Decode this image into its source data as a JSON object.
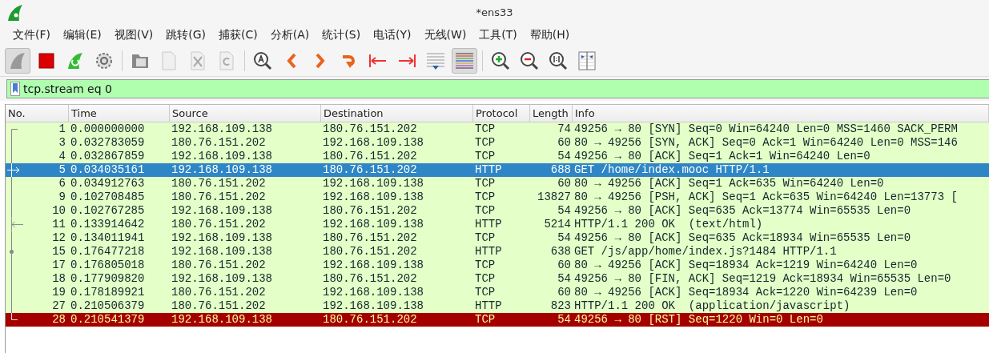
{
  "window": {
    "title": "*ens33"
  },
  "menu": [
    "文件(F)",
    "编辑(E)",
    "视图(V)",
    "跳转(G)",
    "捕获(C)",
    "分析(A)",
    "统计(S)",
    "电话(Y)",
    "无线(W)",
    "工具(T)",
    "帮助(H)"
  ],
  "toolbar": [
    {
      "kind": "start",
      "pressed": true,
      "disabled": false
    },
    {
      "kind": "stop",
      "pressed": false,
      "disabled": false
    },
    {
      "kind": "restart",
      "pressed": false,
      "disabled": false
    },
    {
      "kind": "options",
      "pressed": false,
      "disabled": false
    },
    {
      "kind": "sep"
    },
    {
      "kind": "open",
      "pressed": false,
      "disabled": false
    },
    {
      "kind": "save",
      "pressed": false,
      "disabled": true
    },
    {
      "kind": "close",
      "pressed": false,
      "disabled": true
    },
    {
      "kind": "reload",
      "pressed": false,
      "disabled": true
    },
    {
      "kind": "sep"
    },
    {
      "kind": "find",
      "pressed": false,
      "disabled": false
    },
    {
      "kind": "back",
      "pressed": false,
      "disabled": false
    },
    {
      "kind": "forward",
      "pressed": false,
      "disabled": false
    },
    {
      "kind": "goto",
      "pressed": false,
      "disabled": false
    },
    {
      "kind": "first",
      "pressed": false,
      "disabled": false
    },
    {
      "kind": "last",
      "pressed": false,
      "disabled": false
    },
    {
      "kind": "autoscroll",
      "pressed": false,
      "disabled": false
    },
    {
      "kind": "colorize",
      "pressed": true,
      "disabled": false
    },
    {
      "kind": "sep"
    },
    {
      "kind": "zoom_in",
      "pressed": false,
      "disabled": false
    },
    {
      "kind": "zoom_out",
      "pressed": false,
      "disabled": false
    },
    {
      "kind": "zoom_reset",
      "pressed": false,
      "disabled": false
    },
    {
      "kind": "resize",
      "pressed": false,
      "disabled": false
    }
  ],
  "filter": {
    "value": "tcp.stream eq 0"
  },
  "table": {
    "columns": [
      "No.",
      "Time",
      "Source",
      "Destination",
      "Protocol",
      "Length",
      "Info"
    ],
    "rows": [
      {
        "cells": [
          "1",
          "0.000000000",
          "192.168.109.138",
          "180.76.151.202",
          "TCP",
          "74",
          "49256 → 80 [SYN] Seq=0 Win=64240 Len=0 MSS=1460 SACK_PERM"
        ],
        "selected": false,
        "error": false,
        "kind": "first"
      },
      {
        "cells": [
          "3",
          "0.032783059",
          "180.76.151.202",
          "192.168.109.138",
          "TCP",
          "60",
          "80 → 49256 [SYN, ACK] Seq=0 Ack=1 Win=64240 Len=0 MSS=146"
        ],
        "selected": false,
        "error": false,
        "kind": "member"
      },
      {
        "cells": [
          "4",
          "0.032867859",
          "192.168.109.138",
          "180.76.151.202",
          "TCP",
          "54",
          "49256 → 80 [ACK] Seq=1 Ack=1 Win=64240 Len=0"
        ],
        "selected": false,
        "error": false,
        "kind": "member"
      },
      {
        "cells": [
          "5",
          "0.034035161",
          "192.168.109.138",
          "180.76.151.202",
          "HTTP",
          "688",
          "GET /home/index.mooc HTTP/1.1"
        ],
        "selected": true,
        "error": false,
        "kind": "request"
      },
      {
        "cells": [
          "6",
          "0.034912763",
          "180.76.151.202",
          "192.168.109.138",
          "TCP",
          "60",
          "80 → 49256 [ACK] Seq=1 Ack=635 Win=64240 Len=0"
        ],
        "selected": false,
        "error": false,
        "kind": "member"
      },
      {
        "cells": [
          "9",
          "0.102708485",
          "180.76.151.202",
          "192.168.109.138",
          "TCP",
          "13827",
          "80 → 49256 [PSH, ACK] Seq=1 Ack=635 Win=64240 Len=13773 ["
        ],
        "selected": false,
        "error": false,
        "kind": "member"
      },
      {
        "cells": [
          "10",
          "0.102767285",
          "192.168.109.138",
          "180.76.151.202",
          "TCP",
          "54",
          "49256 → 80 [ACK] Seq=635 Ack=13774 Win=65535 Len=0"
        ],
        "selected": false,
        "error": false,
        "kind": "member"
      },
      {
        "cells": [
          "11",
          "0.133914642",
          "180.76.151.202",
          "192.168.109.138",
          "HTTP",
          "5214",
          "HTTP/1.1 200 OK  (text/html)"
        ],
        "selected": false,
        "error": false,
        "kind": "response"
      },
      {
        "cells": [
          "12",
          "0.134011941",
          "192.168.109.138",
          "180.76.151.202",
          "TCP",
          "54",
          "49256 → 80 [ACK] Seq=635 Ack=18934 Win=65535 Len=0"
        ],
        "selected": false,
        "error": false,
        "kind": "member"
      },
      {
        "cells": [
          "15",
          "0.176477218",
          "192.168.109.138",
          "180.76.151.202",
          "HTTP",
          "638",
          "GET /js/app/home/index.js?1484 HTTP/1.1"
        ],
        "selected": false,
        "error": false,
        "kind": "related"
      },
      {
        "cells": [
          "17",
          "0.176805018",
          "180.76.151.202",
          "192.168.109.138",
          "TCP",
          "60",
          "80 → 49256 [ACK] Seq=18934 Ack=1219 Win=64240 Len=0"
        ],
        "selected": false,
        "error": false,
        "kind": "member"
      },
      {
        "cells": [
          "18",
          "0.177909820",
          "192.168.109.138",
          "180.76.151.202",
          "TCP",
          "54",
          "49256 → 80 [FIN, ACK] Seq=1219 Ack=18934 Win=65535 Len=0"
        ],
        "selected": false,
        "error": false,
        "kind": "member"
      },
      {
        "cells": [
          "19",
          "0.178189921",
          "180.76.151.202",
          "192.168.109.138",
          "TCP",
          "60",
          "80 → 49256 [ACK] Seq=18934 Ack=1220 Win=64239 Len=0"
        ],
        "selected": false,
        "error": false,
        "kind": "member"
      },
      {
        "cells": [
          "27",
          "0.210506379",
          "180.76.151.202",
          "192.168.109.138",
          "HTTP",
          "823",
          "HTTP/1.1 200 OK  (application/javascript)"
        ],
        "selected": false,
        "error": false,
        "kind": "member"
      },
      {
        "cells": [
          "28",
          "0.210541379",
          "192.168.109.138",
          "180.76.151.202",
          "TCP",
          "54",
          "49256 → 80 [RST] Seq=1220 Win=0 Len=0"
        ],
        "selected": false,
        "error": true,
        "kind": "last"
      }
    ]
  }
}
